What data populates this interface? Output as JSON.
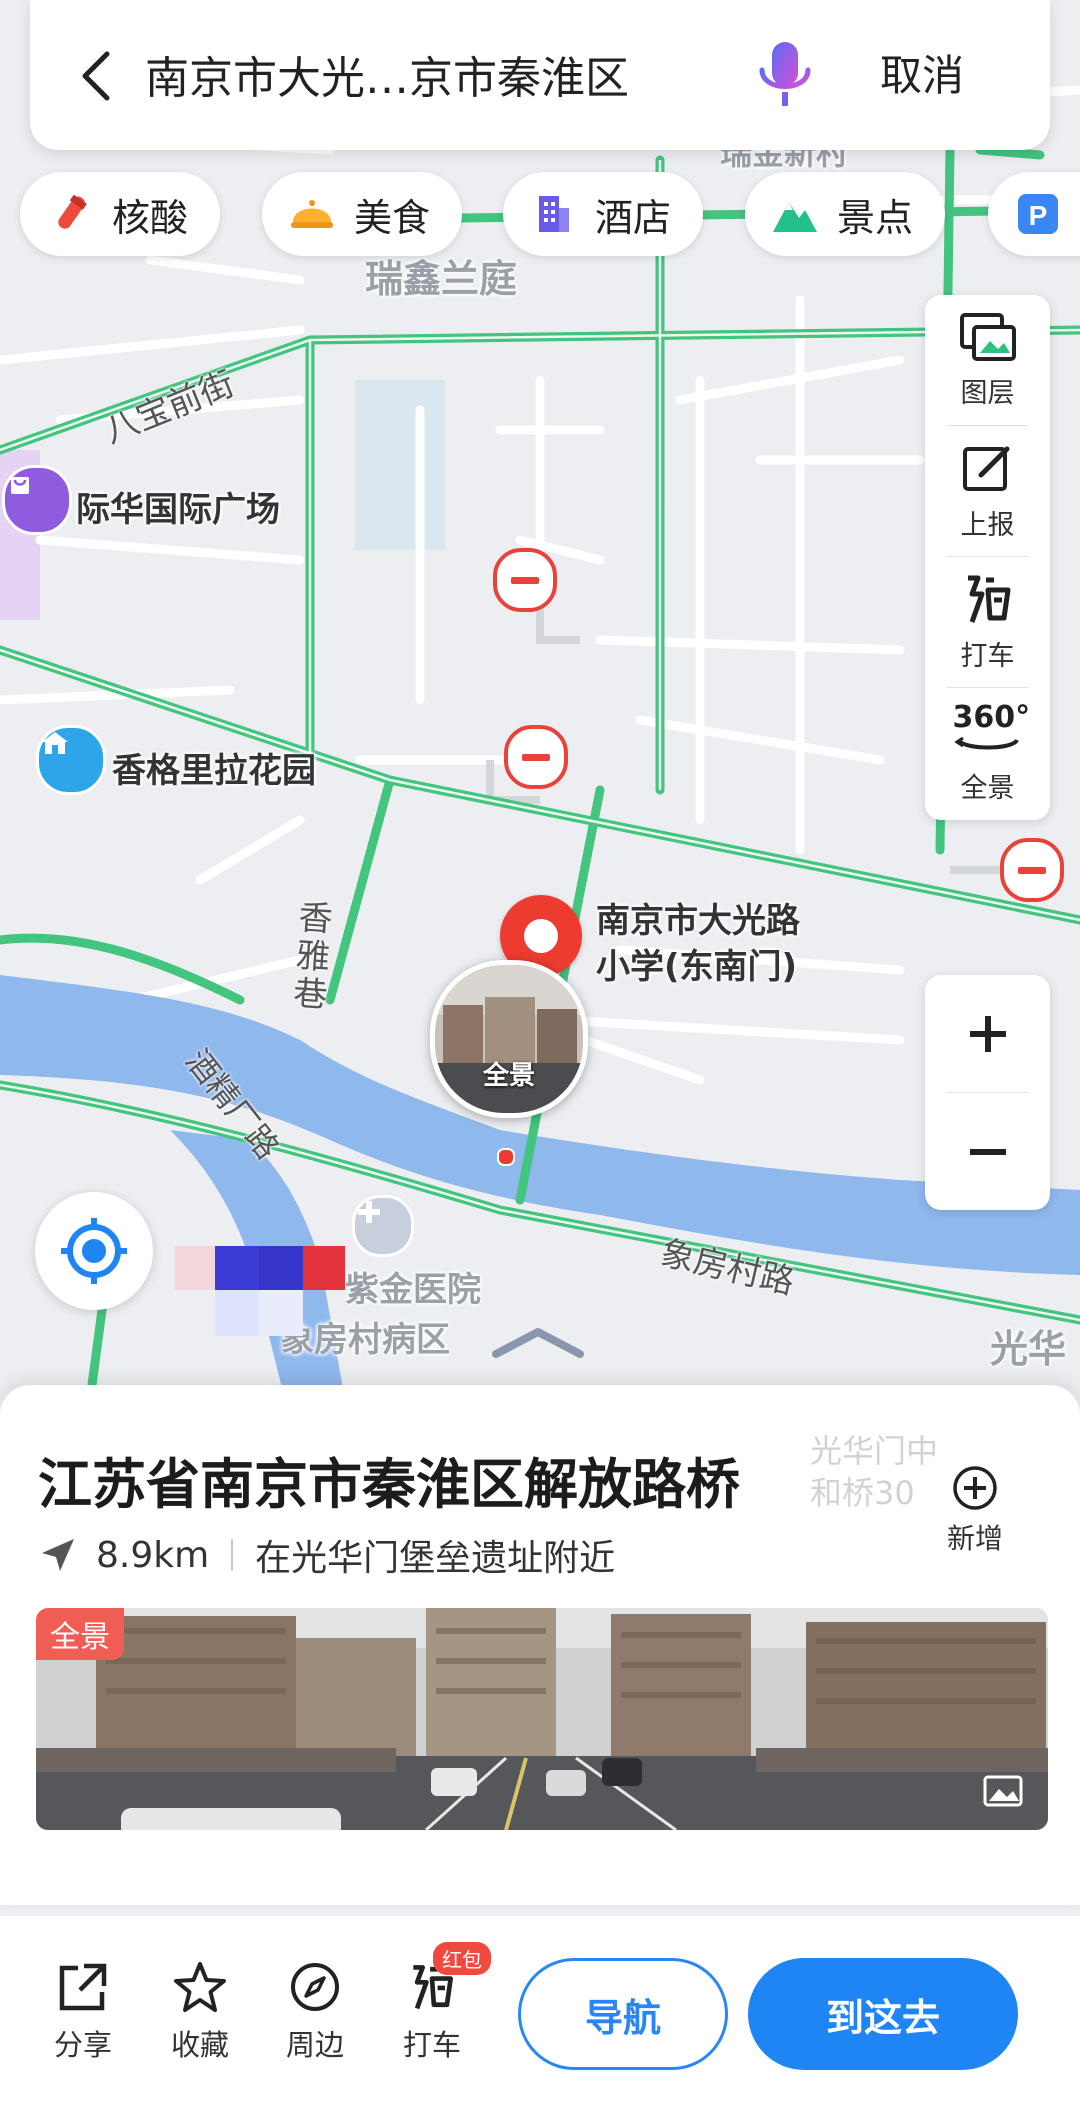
{
  "search": {
    "query": "南京市大光…京市秦淮区",
    "cancel_label": "取消"
  },
  "categories": [
    {
      "label": "核酸",
      "icon": "test-tube-icon"
    },
    {
      "label": "美食",
      "icon": "food-icon"
    },
    {
      "label": "酒店",
      "icon": "hotel-icon"
    },
    {
      "label": "景点",
      "icon": "mountain-icon"
    },
    {
      "label": "",
      "icon": "parking-icon"
    }
  ],
  "tools": [
    {
      "label": "图层",
      "icon": "layers-icon"
    },
    {
      "label": "上报",
      "icon": "report-icon"
    },
    {
      "label": "打车",
      "icon": "taxi-icon"
    },
    {
      "label": "全景",
      "icon": "panorama-360-icon",
      "badge": "360°"
    }
  ],
  "map": {
    "labels": {
      "area_top": "瑞金新村",
      "ruixin": "瑞鑫兰庭",
      "babao": "八宝前街",
      "jihua": "际华国际广场",
      "shangri": "香格里拉花园",
      "xiangya": "香雅巷",
      "jiujing": "酒精厂路",
      "xiangfang": "象房村路",
      "hospital_1": "紫金医院",
      "hospital_2": "象房村病区",
      "guanghua_right": "光华",
      "guanghua_gate": "光华门中",
      "guanghua_bridge": "和桥30",
      "poi_name": "南京市大光路小学(东南门)",
      "poi_line1": "南京市大光路",
      "poi_line2": "小学(东南门)",
      "pano_thumb": "全景"
    }
  },
  "place": {
    "title": "江苏省南京市秦淮区解放路桥",
    "distance": "8.9km",
    "near": "在光华门堡垒遗址附近",
    "add_label": "新增",
    "pano_tag": "全景"
  },
  "bottom": {
    "share": "分享",
    "favorite": "收藏",
    "nearby": "周边",
    "taxi": "打车",
    "taxi_badge": "红包",
    "navigate": "导航",
    "go_here": "到这去"
  },
  "colors": {
    "road_green": "#43c47f",
    "river": "#8fb8ec",
    "accent_blue": "#1f85f4",
    "poi_red": "#ee3b30"
  }
}
